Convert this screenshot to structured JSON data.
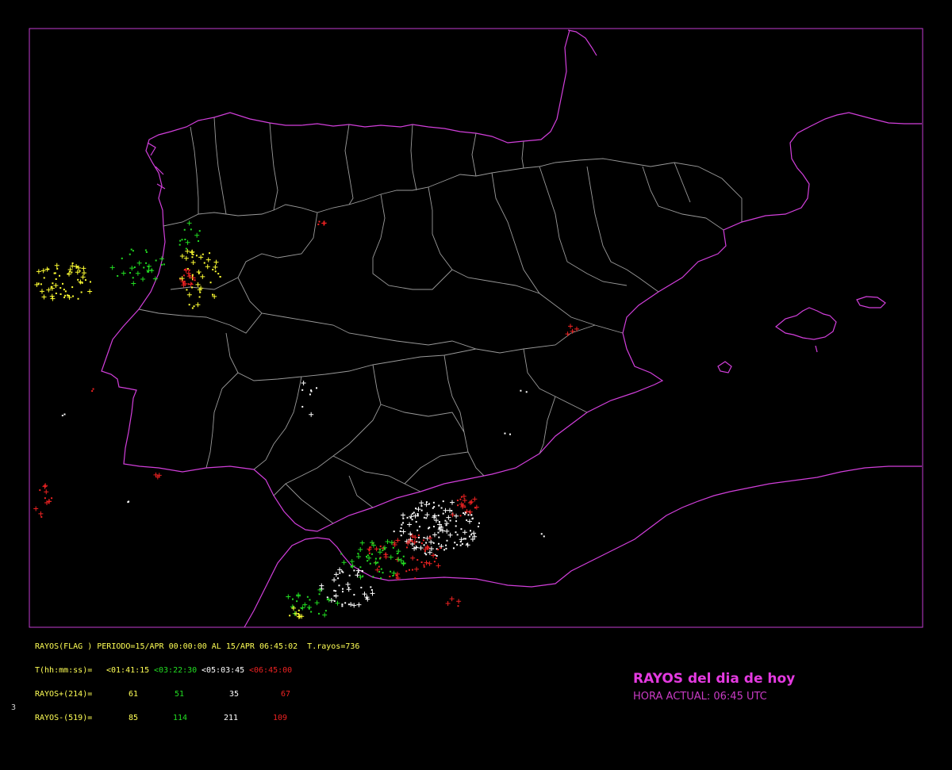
{
  "colors": {
    "background": "#000000",
    "frame": "#c23bd0",
    "coast": "#d23fdb",
    "borders": "#9a9a9a",
    "yellow": "#ffff33",
    "green": "#22dd22",
    "white": "#ffffff",
    "red": "#ee2222",
    "title": "#e43ae0"
  },
  "legend": {
    "line1": "RAYOS(FLAG ) PERIODO=15/APR 00:00:00 AL 15/APR 06:45:02  T.rayos=736",
    "line2_label": "T(hh:mm:ss)= ",
    "intervals": [
      "<01:41:15",
      "<03:22:30",
      "<05:03:45",
      "<06:45:00"
    ],
    "positive_label": "RAYOS+(214)=",
    "positive_counts": [
      "61",
      "51",
      "35",
      "67"
    ],
    "negative_label": "RAYOS-(519)=",
    "negative_counts": [
      "85",
      "114",
      "211",
      "109"
    ]
  },
  "title": "RAYOS del dia de hoy",
  "subtitle": "HORA ACTUAL: 06:45 UTC",
  "page_number": "3",
  "icons": {
    "positive_strike": "plus-marker",
    "negative_strike": "dot-marker"
  }
}
